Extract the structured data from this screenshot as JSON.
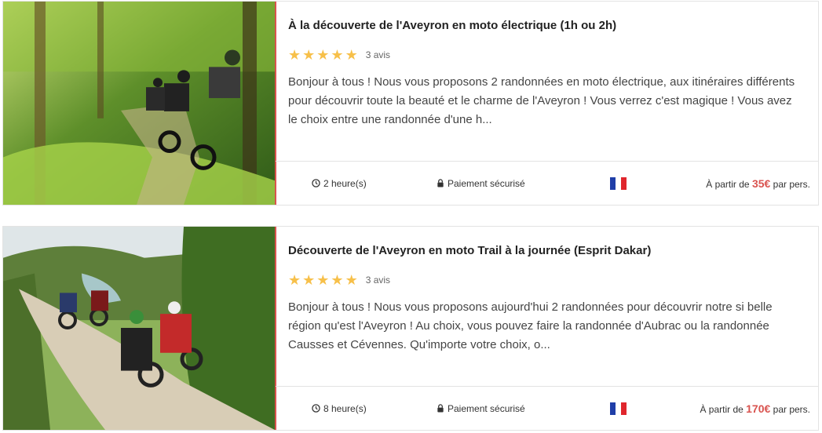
{
  "listings": [
    {
      "title": "À la découverte de l'Aveyron en moto électrique (1h ou 2h)",
      "reviews": "3 avis",
      "description": "Bonjour à tous ! Nous vous proposons 2 randonnées en moto électrique, aux itinéraires différents pour découvrir toute la beauté et le charme de l'Aveyron ! Vous verrez c'est magique ! Vous avez le choix entre une randonnée d'une h...",
      "duration": "2 heure(s)",
      "payment": "Paiement sécurisé",
      "price_prefix": "À partir de",
      "price": "35€",
      "price_suffix": "par pers."
    },
    {
      "title": "Découverte de l'Aveyron en moto Trail à la journée (Esprit Dakar)",
      "reviews": "3 avis",
      "description": "Bonjour à tous ! Nous vous proposons aujourd'hui 2 randonnées pour découvrir notre si belle région qu'est l'Aveyron ! Au choix, vous pouvez faire la randonnée d'Aubrac ou la randonnée Causses et Cévennes. Qu'importe votre choix, o...",
      "duration": "8 heure(s)",
      "payment": "Paiement sécurisé",
      "price_prefix": "À partir de",
      "price": "170€",
      "price_suffix": "par pers."
    }
  ],
  "colors": {
    "accent": "#d9534f",
    "star": "#f7c04a",
    "border": "#e3e3e3"
  },
  "icons": {
    "rating": "star-icon",
    "duration": "clock-icon",
    "payment": "lock-icon",
    "language": "french-flag-icon"
  }
}
